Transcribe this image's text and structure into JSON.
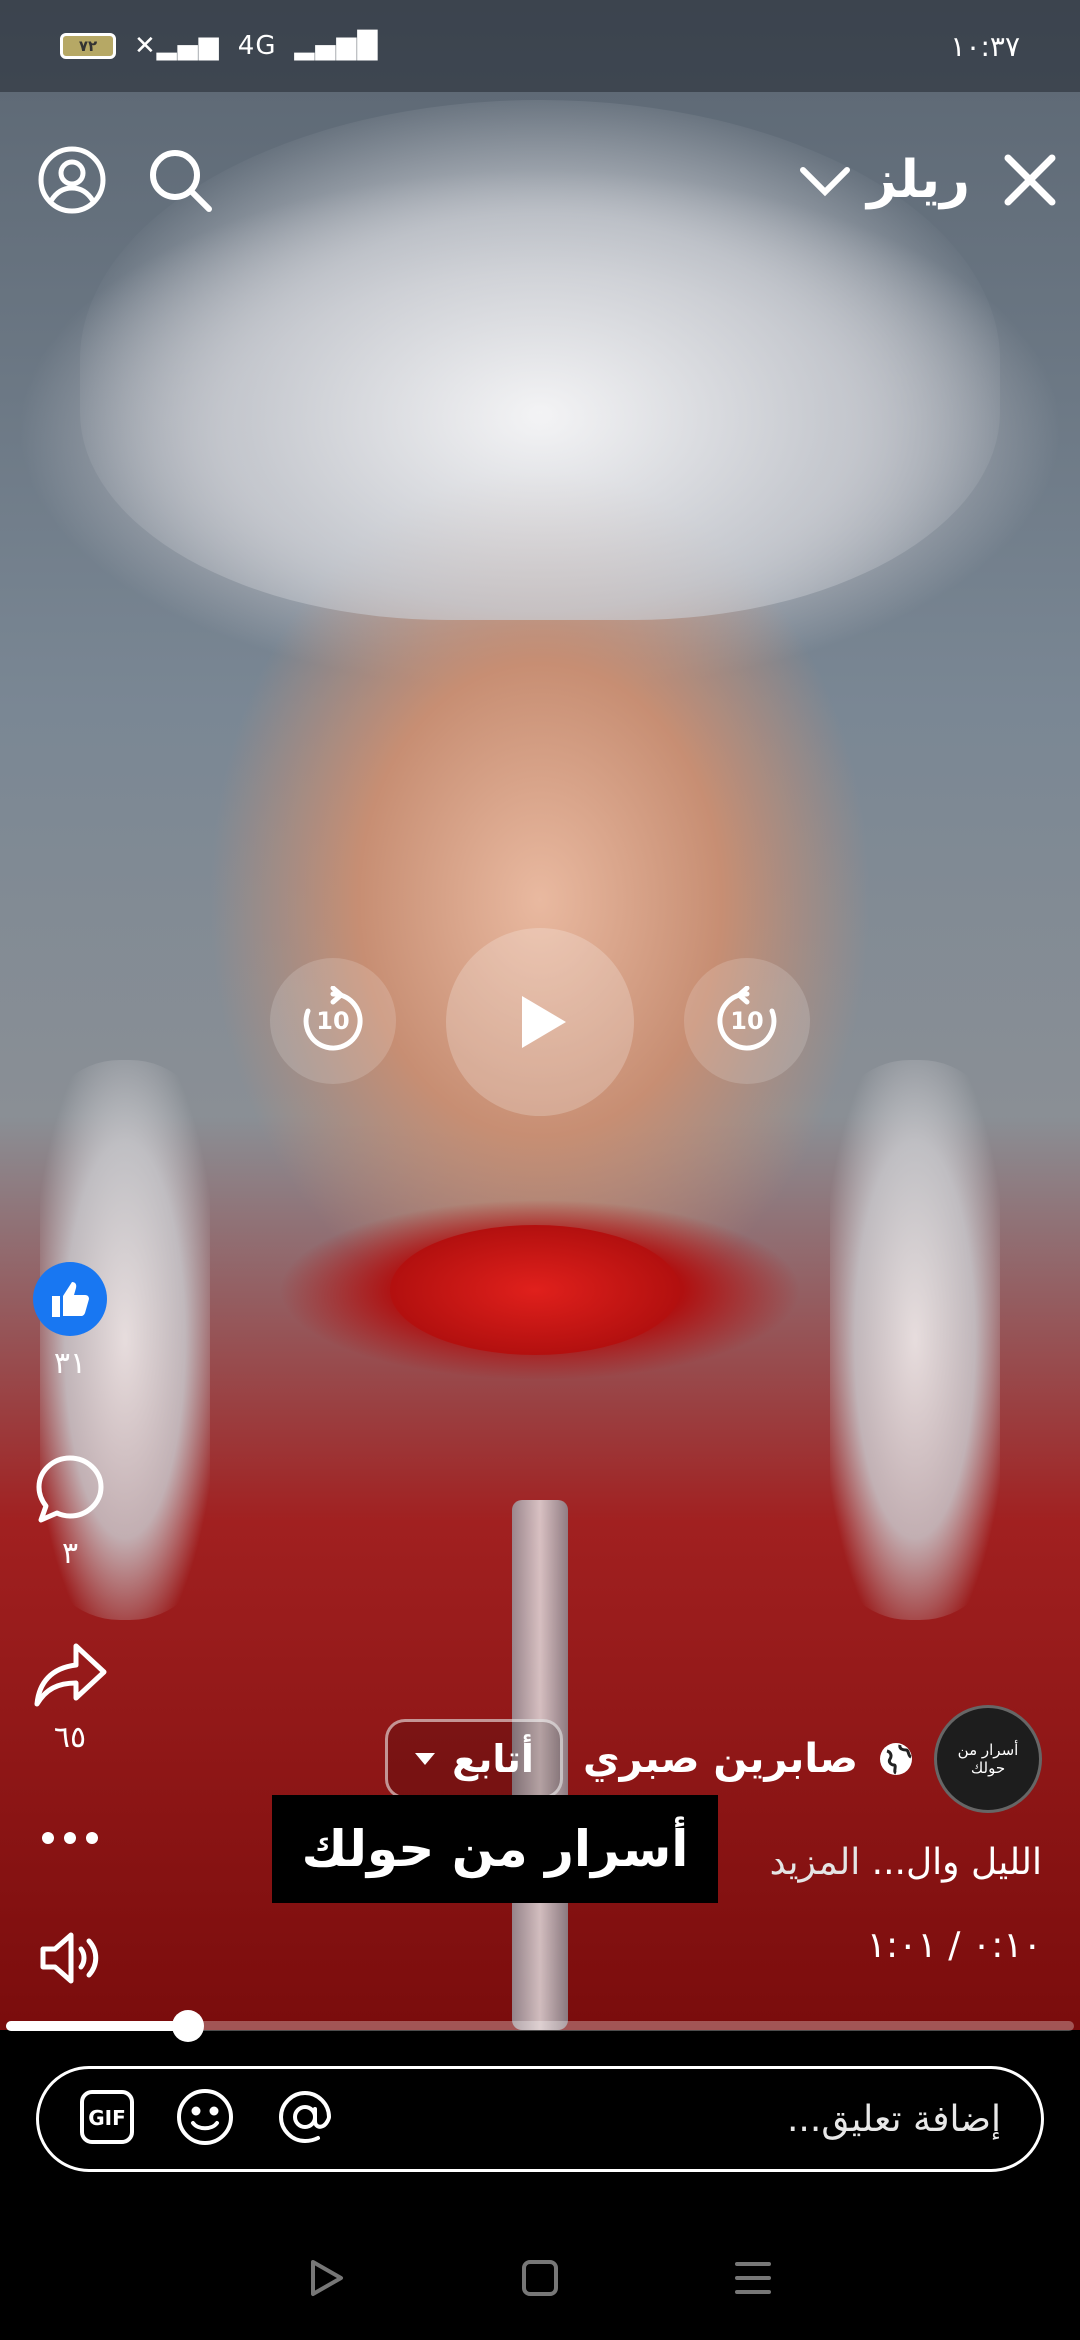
{
  "status_bar": {
    "battery": "٧٢",
    "network": "4G",
    "time": "١٠:٣٧"
  },
  "header": {
    "title": "ريلز",
    "icons": [
      "close-icon",
      "chevron-down-icon",
      "search-icon",
      "profile-icon"
    ]
  },
  "player": {
    "rewind_seconds": "10",
    "forward_seconds": "10",
    "state": "paused",
    "progress_fraction": 0.17
  },
  "actions": {
    "likes": "٣١",
    "comments": "٣",
    "shares": "٦٥"
  },
  "post": {
    "avatar_text": "أسرار من حولك",
    "author": "صابرين صبري",
    "follow_label": "أتابع",
    "overlay_text": "أسرار من حولك",
    "caption": "الليل وال...",
    "more_label": "المزيد",
    "time": "٠:١٠ / ١:٠١"
  },
  "comment_bar": {
    "placeholder": "إضافة تعليق...",
    "gif_label": "GIF"
  },
  "colors": {
    "like_blue": "#1877f2",
    "background": "#000000"
  }
}
